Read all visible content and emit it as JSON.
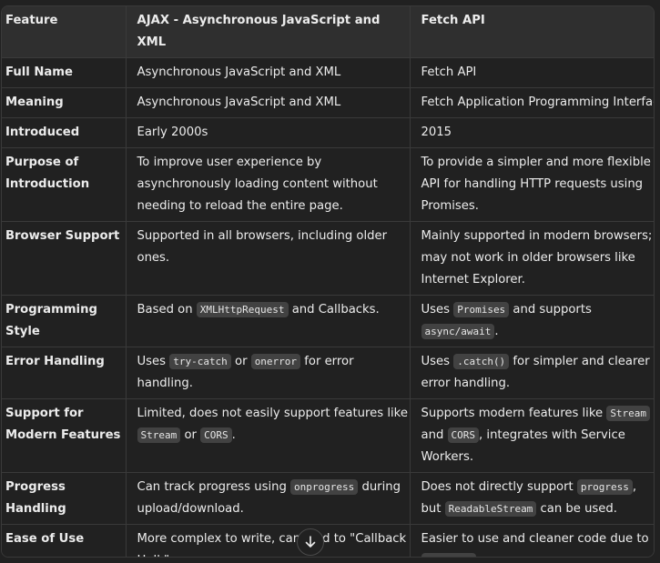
{
  "headers": [
    "Feature",
    "AJAX - Asynchronous JavaScript and XML",
    "Fetch API"
  ],
  "rows": [
    {
      "feature": [
        "Full Name"
      ],
      "ajax": [
        {
          "t": "Asynchronous JavaScript and XML"
        }
      ],
      "fetch": [
        {
          "t": "Fetch API"
        }
      ]
    },
    {
      "feature": [
        "Meaning"
      ],
      "ajax": [
        {
          "t": "Asynchronous JavaScript and XML"
        }
      ],
      "fetch": [
        {
          "t": "Fetch Application Programming Interface"
        }
      ]
    },
    {
      "feature": [
        "Introduced"
      ],
      "ajax": [
        {
          "t": "Early 2000s"
        }
      ],
      "fetch": [
        {
          "t": "2015"
        }
      ]
    },
    {
      "feature": [
        "Purpose of",
        "Introduction"
      ],
      "ajax": [
        {
          "t": "To improve user experience by asynchronously loading content without needing to reload the entire page."
        }
      ],
      "fetch": [
        {
          "t": "To provide a simpler and more flexible API for handling HTTP requests using Promises."
        }
      ]
    },
    {
      "feature": [
        "Browser Support"
      ],
      "ajax": [
        {
          "t": "Supported in all browsers, including older ones."
        }
      ],
      "fetch": [
        {
          "t": "Mainly supported in modern browsers; may not work in older browsers like Internet Explorer."
        }
      ]
    },
    {
      "feature": [
        "Programming",
        "Style"
      ],
      "ajax": [
        {
          "t": "Based on "
        },
        {
          "c": "XMLHttpRequest"
        },
        {
          "t": " and Callbacks."
        }
      ],
      "fetch": [
        {
          "t": "Uses "
        },
        {
          "c": "Promises"
        },
        {
          "t": " and supports "
        },
        {
          "c": "async/await"
        },
        {
          "t": "."
        }
      ]
    },
    {
      "feature": [
        "Error Handling"
      ],
      "ajax": [
        {
          "t": "Uses "
        },
        {
          "c": "try-catch"
        },
        {
          "t": " or "
        },
        {
          "c": "onerror"
        },
        {
          "t": " for error handling."
        }
      ],
      "fetch": [
        {
          "t": "Uses "
        },
        {
          "c": ".catch()"
        },
        {
          "t": " for simpler and clearer error handling."
        }
      ]
    },
    {
      "feature": [
        "Support for",
        "Modern Features"
      ],
      "ajax": [
        {
          "t": "Limited, does not easily support features like "
        },
        {
          "c": "Stream"
        },
        {
          "t": " or "
        },
        {
          "c": "CORS"
        },
        {
          "t": "."
        }
      ],
      "fetch": [
        {
          "t": "Supports modern features like "
        },
        {
          "c": "Stream"
        },
        {
          "t": " and "
        },
        {
          "c": "CORS"
        },
        {
          "t": ", integrates with Service Workers."
        }
      ]
    },
    {
      "feature": [
        "Progress Handling"
      ],
      "ajax": [
        {
          "t": "Can track progress using "
        },
        {
          "c": "onprogress"
        },
        {
          "t": " during upload/download."
        }
      ],
      "fetch": [
        {
          "t": "Does not directly support "
        },
        {
          "c": "progress"
        },
        {
          "t": ", but "
        },
        {
          "c": "ReadableStream"
        },
        {
          "t": " can be used."
        }
      ]
    },
    {
      "feature": [
        "Ease of Use"
      ],
      "ajax": [
        {
          "t": "More complex to write, can lead to \"Callback Hell.\""
        }
      ],
      "fetch": [
        {
          "t": "Easier to use and cleaner code due to "
        },
        {
          "c": "Promises"
        },
        {
          "t": "."
        }
      ]
    }
  ],
  "scroll_button": {
    "icon": "arrow-down-icon"
  }
}
